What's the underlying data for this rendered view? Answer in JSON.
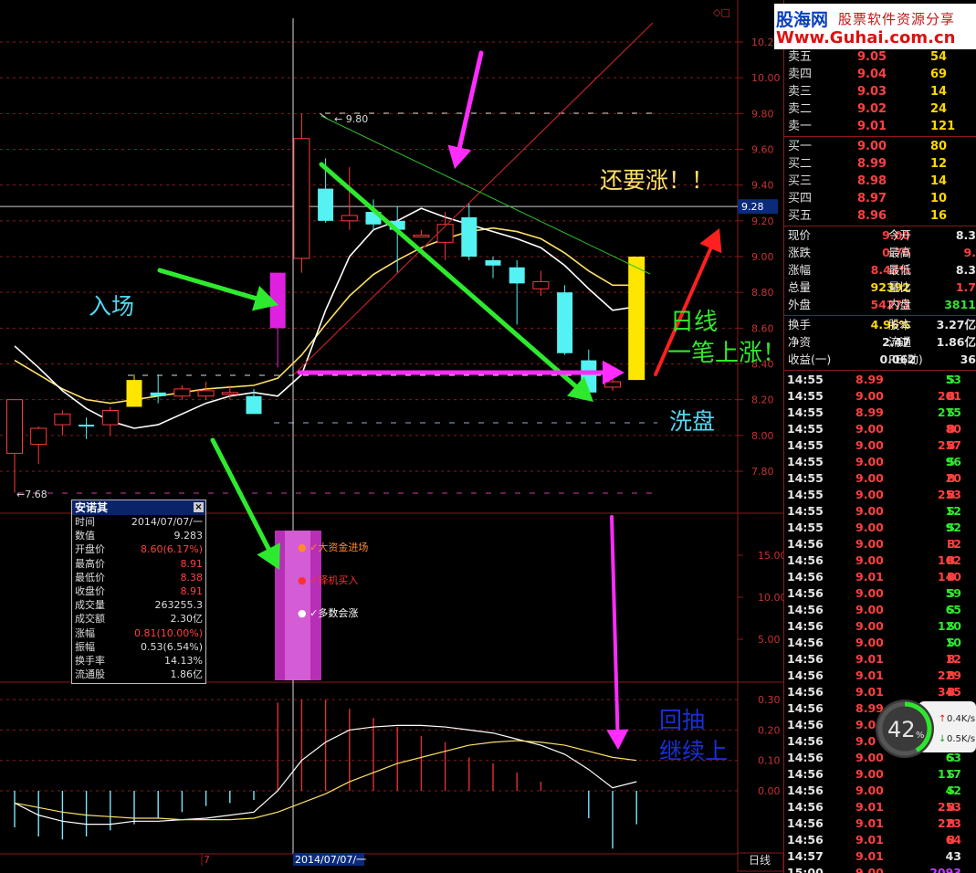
{
  "colors": {
    "up": "#ff3b3b",
    "down": "#54f2f2",
    "ma5": "#ffffff",
    "ma10": "#ffe066",
    "grid": "#8a1a1a",
    "magenta": "#ff2cff",
    "green": "#2eea2e"
  },
  "chart_data": {
    "type": "candlestick",
    "title": "",
    "y_ticks": [
      "10.20",
      "10.00",
      "9.80",
      "9.60",
      "9.40",
      "9.20",
      "9.00",
      "8.80",
      "8.60",
      "8.40",
      "8.20",
      "8.00",
      "7.80"
    ],
    "ylim": [
      7.64,
      10.24
    ],
    "current_price_label": "9.28",
    "high_label": "9.80",
    "low_label": "7.68",
    "date_label": "2014/07/07/一",
    "x_label_left": "7",
    "period_label": "日线",
    "candles": [
      {
        "o": 7.9,
        "h": 8.2,
        "l": 7.68,
        "c": 8.2
      },
      {
        "o": 7.95,
        "h": 8.05,
        "l": 7.84,
        "c": 8.04
      },
      {
        "o": 8.06,
        "h": 8.14,
        "l": 8.0,
        "c": 8.12
      },
      {
        "o": 8.06,
        "h": 8.1,
        "l": 7.98,
        "c": 8.05
      },
      {
        "o": 8.06,
        "h": 8.16,
        "l": 8.0,
        "c": 8.14
      },
      {
        "o": 8.16,
        "h": 8.34,
        "l": 8.16,
        "c": 8.31
      },
      {
        "o": 8.24,
        "h": 8.34,
        "l": 8.18,
        "c": 8.22
      },
      {
        "o": 8.22,
        "h": 8.28,
        "l": 8.2,
        "c": 8.26
      },
      {
        "o": 8.22,
        "h": 8.3,
        "l": 8.2,
        "c": 8.25
      },
      {
        "o": 8.23,
        "h": 8.28,
        "l": 8.2,
        "c": 8.24
      },
      {
        "o": 8.22,
        "h": 8.26,
        "l": 8.12,
        "c": 8.12
      },
      {
        "o": 8.6,
        "h": 8.91,
        "l": 8.38,
        "c": 8.91
      },
      {
        "o": 8.99,
        "h": 9.8,
        "l": 8.91,
        "c": 9.66
      },
      {
        "o": 9.38,
        "h": 9.55,
        "l": 9.19,
        "c": 9.2
      },
      {
        "o": 9.2,
        "h": 9.5,
        "l": 9.15,
        "c": 9.23
      },
      {
        "o": 9.25,
        "h": 9.32,
        "l": 9.15,
        "c": 9.18
      },
      {
        "o": 9.2,
        "h": 9.28,
        "l": 8.91,
        "c": 9.15
      },
      {
        "o": 9.12,
        "h": 9.15,
        "l": 9.12,
        "c": 9.12
      },
      {
        "o": 9.08,
        "h": 9.25,
        "l": 8.98,
        "c": 9.18
      },
      {
        "o": 9.22,
        "h": 9.3,
        "l": 8.98,
        "c": 9.0
      },
      {
        "o": 8.98,
        "h": 9.0,
        "l": 8.88,
        "c": 8.95
      },
      {
        "o": 8.94,
        "h": 8.98,
        "l": 8.62,
        "c": 8.85
      },
      {
        "o": 8.82,
        "h": 8.92,
        "l": 8.78,
        "c": 8.86
      },
      {
        "o": 8.8,
        "h": 8.84,
        "l": 8.45,
        "c": 8.46
      },
      {
        "o": 8.42,
        "h": 8.48,
        "l": 8.2,
        "c": 8.24
      },
      {
        "o": 8.27,
        "h": 8.34,
        "l": 8.25,
        "c": 8.3
      },
      {
        "o": 8.31,
        "h": 9.0,
        "l": 8.31,
        "c": 9.0
      }
    ],
    "ma5": [
      8.5,
      8.38,
      8.25,
      8.15,
      8.08,
      8.04,
      8.06,
      8.12,
      8.18,
      8.22,
      8.24,
      8.22,
      8.34,
      8.7,
      9.0,
      9.15,
      9.2,
      9.27,
      9.22,
      9.18,
      9.14,
      9.1,
      9.05,
      8.95,
      8.82,
      8.7,
      8.72
    ],
    "ma10": [
      8.4,
      8.35,
      8.3,
      8.26,
      8.23,
      8.21,
      8.2,
      8.19,
      8.18,
      8.18,
      8.18,
      8.2,
      8.26,
      8.38,
      8.52,
      8.62,
      8.72,
      8.84,
      8.95,
      9.0,
      9.04,
      9.05,
      9.04,
      9.02,
      8.98,
      8.88,
      8.84
    ],
    "indicator_ticks": [
      "15.00",
      "10.00",
      "5.00"
    ],
    "macd_ticks": [
      "0.30",
      "0.20",
      "0.10",
      "0.00"
    ],
    "macd_hist": [
      -0.12,
      -0.15,
      -0.16,
      -0.15,
      -0.13,
      -0.11,
      -0.09,
      -0.07,
      -0.05,
      -0.04,
      -0.03,
      0.29,
      0.3,
      0.3,
      0.27,
      0.24,
      0.21,
      0.18,
      0.16,
      0.11,
      0.09,
      0.06,
      0.03,
      0,
      -0.09,
      -0.19,
      -0.11
    ],
    "macd_line": [
      -0.04,
      -0.08,
      -0.1,
      -0.11,
      -0.11,
      -0.1,
      -0.1,
      -0.095,
      -0.09,
      -0.08,
      -0.07,
      0.0,
      0.1,
      0.16,
      0.2,
      0.21,
      0.215,
      0.215,
      0.21,
      0.2,
      0.19,
      0.17,
      0.15,
      0.12,
      0.07,
      0.01,
      0.03
    ],
    "signal_line": [
      -0.04,
      -0.055,
      -0.07,
      -0.08,
      -0.085,
      -0.09,
      -0.09,
      -0.095,
      -0.095,
      -0.095,
      -0.09,
      -0.07,
      -0.04,
      -0.01,
      0.03,
      0.06,
      0.09,
      0.11,
      0.13,
      0.15,
      0.16,
      0.165,
      0.16,
      0.15,
      0.13,
      0.11,
      0.1
    ]
  },
  "annotations": {
    "entry": "入场",
    "keep_rising": "还要涨！！",
    "daily_line_1": "日线",
    "daily_line_2": "一笔上涨！！",
    "wash": "洗盘",
    "pullback_1": "回抽",
    "pullback_2": "继续上",
    "signal_1": "大资金进场",
    "signal_2": "择机买入",
    "signal_3": "多数会涨"
  },
  "popup": {
    "title": "安诺其",
    "close": "×",
    "rows": [
      {
        "k": "时间",
        "v": "2014/07/07/一",
        "c": "#ddd"
      },
      {
        "k": "数值",
        "v": "9.283",
        "c": "#ddd"
      },
      {
        "k": "开盘价",
        "v": "8.60(6.17%)",
        "c": "#ff4040"
      },
      {
        "k": "最高价",
        "v": "8.91",
        "c": "#ff4040"
      },
      {
        "k": "最低价",
        "v": "8.38",
        "c": "#ff4040"
      },
      {
        "k": "收盘价",
        "v": "8.91",
        "c": "#ff4040"
      },
      {
        "k": "成交量",
        "v": "263255.3",
        "c": "#ddd"
      },
      {
        "k": "成交额",
        "v": "2.30亿",
        "c": "#ddd"
      },
      {
        "k": "涨幅",
        "v": "0.81(10.00%)",
        "c": "#ff4040"
      },
      {
        "k": "振幅",
        "v": "0.53(6.54%)",
        "c": "#ddd"
      },
      {
        "k": "换手率",
        "v": "14.13%",
        "c": "#ddd"
      },
      {
        "k": "流通股",
        "v": "1.86亿",
        "c": "#ddd"
      }
    ]
  },
  "logo": {
    "line1": "股海网",
    "line1b": "股票软件资源分享",
    "line2": "Www.Guhai.com.cn"
  },
  "quotes": {
    "sell": [
      {
        "label": "卖五",
        "price": "9.05",
        "vol": "54"
      },
      {
        "label": "卖四",
        "price": "9.04",
        "vol": "69"
      },
      {
        "label": "卖三",
        "price": "9.03",
        "vol": "14"
      },
      {
        "label": "卖二",
        "price": "9.02",
        "vol": "24"
      },
      {
        "label": "卖一",
        "price": "9.01",
        "vol": "121"
      }
    ],
    "buy": [
      {
        "label": "买一",
        "price": "9.00",
        "vol": "80"
      },
      {
        "label": "买二",
        "price": "8.99",
        "vol": "12"
      },
      {
        "label": "买三",
        "price": "8.98",
        "vol": "14"
      },
      {
        "label": "买四",
        "price": "8.97",
        "vol": "10"
      },
      {
        "label": "买五",
        "price": "8.96",
        "vol": "16"
      }
    ]
  },
  "stats": [
    {
      "k1": "现价",
      "v1": "9.00",
      "c1": "red",
      "k2": "今开",
      "v2": "8.3",
      "c2": "wht"
    },
    {
      "k1": "涨跌",
      "v1": "0.70",
      "c1": "red",
      "k2": "最高",
      "v2": "9.",
      "c2": "red"
    },
    {
      "k1": "涨幅",
      "v1": "8.43%",
      "c1": "red",
      "k2": "最低",
      "v2": "8.3",
      "c2": "wht"
    },
    {
      "k1": "总量",
      "v1": "92392",
      "c1": "yel",
      "k2": "量比",
      "v2": "1.7",
      "c2": "red"
    },
    {
      "k1": "外盘",
      "v1": "54273",
      "c1": "red",
      "k2": "内盘",
      "v2": "3811",
      "c2": "green"
    },
    {
      "k1": "换手",
      "v1": "4.96%",
      "c1": "yel",
      "k2": "股本",
      "v2": "3.27亿",
      "c2": "wht"
    },
    {
      "k1": "净资",
      "v1": "2.47",
      "c1": "wht",
      "k2": "流通",
      "v2": "1.86亿",
      "c2": "wht"
    },
    {
      "k1": "收益(一)",
      "v1": "0.062",
      "c1": "wht",
      "k2": "PE(动)",
      "v2": "36",
      "c2": "wht"
    }
  ],
  "ticks": [
    {
      "t": "14:55",
      "p": "8.99",
      "v": "53",
      "s": "S"
    },
    {
      "t": "14:55",
      "p": "9.00",
      "v": "201",
      "s": "B"
    },
    {
      "t": "14:55",
      "p": "8.99",
      "v": "275",
      "s": "S"
    },
    {
      "t": "14:55",
      "p": "9.00",
      "v": "80",
      "s": "B"
    },
    {
      "t": "14:55",
      "p": "9.00",
      "v": "257",
      "s": "B"
    },
    {
      "t": "14:55",
      "p": "9.00",
      "v": "96",
      "s": "S"
    },
    {
      "t": "14:55",
      "p": "9.00",
      "v": "20",
      "s": "B"
    },
    {
      "t": "14:55",
      "p": "9.00",
      "v": "253",
      "s": "B"
    },
    {
      "t": "14:55",
      "p": "9.00",
      "v": "12",
      "s": "S"
    },
    {
      "t": "14:55",
      "p": "9.00",
      "v": "92",
      "s": "S"
    },
    {
      "t": "14:56",
      "p": "9.00",
      "v": "2",
      "s": "B"
    },
    {
      "t": "14:56",
      "p": "9.00",
      "v": "102",
      "s": "B"
    },
    {
      "t": "14:56",
      "p": "9.01",
      "v": "140",
      "s": "B"
    },
    {
      "t": "14:56",
      "p": "9.00",
      "v": "59",
      "s": "S"
    },
    {
      "t": "14:56",
      "p": "9.00",
      "v": "65",
      "s": "S"
    },
    {
      "t": "14:56",
      "p": "9.00",
      "v": "120",
      "s": "S"
    },
    {
      "t": "14:56",
      "p": "9.00",
      "v": "10",
      "s": "S"
    },
    {
      "t": "14:56",
      "p": "9.01",
      "v": "12",
      "s": "B"
    },
    {
      "t": "14:56",
      "p": "9.01",
      "v": "229",
      "s": "B"
    },
    {
      "t": "14:56",
      "p": "9.01",
      "v": "345",
      "s": "B"
    },
    {
      "t": "14:56",
      "p": "8.99",
      "v": "",
      "s": ""
    },
    {
      "t": "14:56",
      "p": "9.0",
      "v": "",
      "s": ""
    },
    {
      "t": "14:56",
      "p": "9.0",
      "v": "",
      "s": ""
    },
    {
      "t": "14:56",
      "p": "9.00",
      "v": "63",
      "s": "S"
    },
    {
      "t": "14:56",
      "p": "9.00",
      "v": "117",
      "s": "S"
    },
    {
      "t": "14:56",
      "p": "9.00",
      "v": "42",
      "s": "S"
    },
    {
      "t": "14:56",
      "p": "9.01",
      "v": "253",
      "s": "B"
    },
    {
      "t": "14:56",
      "p": "9.01",
      "v": "223",
      "s": "B"
    },
    {
      "t": "14:56",
      "p": "9.01",
      "v": "64",
      "s": "B"
    },
    {
      "t": "14:57",
      "p": "9.01",
      "v": "43",
      "s": ""
    },
    {
      "t": "15:00",
      "p": "9.00",
      "v": "2093",
      "s": ""
    }
  ],
  "gauge": {
    "percent": 42,
    "percent_label": "42",
    "unit": "%",
    "up_rate": "0.4K/s",
    "down_rate": "0.5K/s"
  }
}
